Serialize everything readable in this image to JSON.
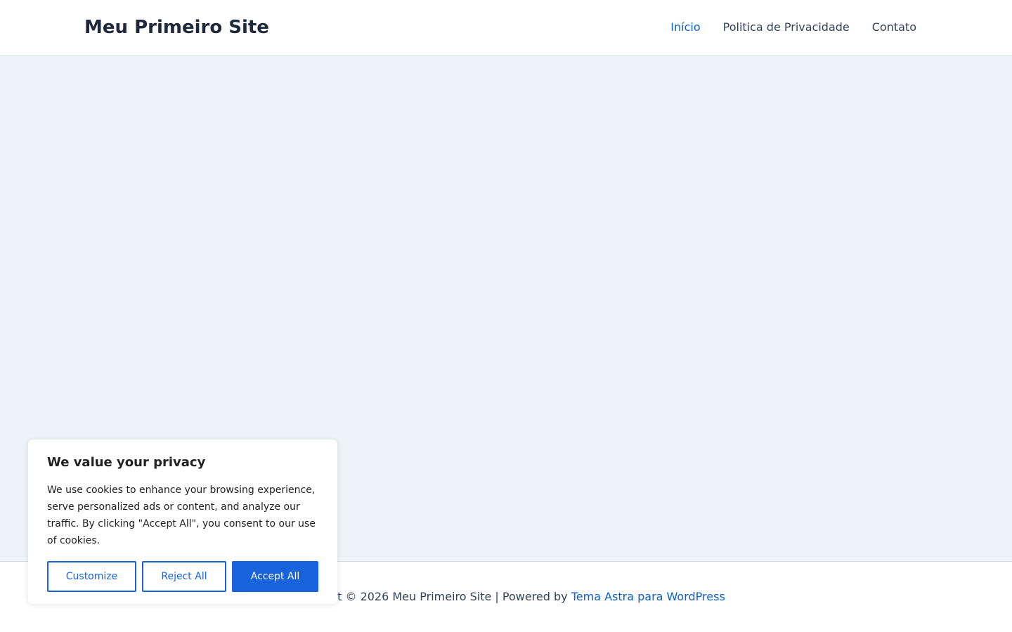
{
  "header": {
    "site_title": "Meu Primeiro Site",
    "nav": [
      {
        "label": "Início",
        "active": true
      },
      {
        "label": "Politica de Privacidade",
        "active": false
      },
      {
        "label": "Contato",
        "active": false
      }
    ]
  },
  "footer": {
    "copyright": "Copyright © 2026 Meu Primeiro Site | Powered by ",
    "link_label": "Tema Astra para WordPress"
  },
  "cookie_banner": {
    "title": "We value your privacy",
    "text": "We use cookies to enhance your browsing experience, serve personalized ads or content, and analyze our traffic. By clicking \"Accept All\", you consent to our use of cookies.",
    "customize_label": "Customize",
    "reject_label": "Reject All",
    "accept_label": "Accept All"
  },
  "colors": {
    "accent": "#0b62c4",
    "button_blue": "#1863dc",
    "content_background": "#eef3f9"
  }
}
